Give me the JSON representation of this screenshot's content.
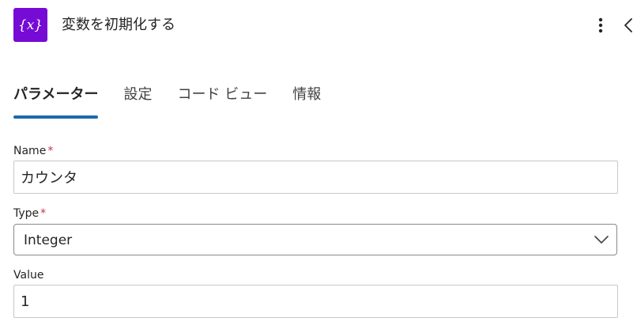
{
  "header": {
    "title": "変数を初期化する",
    "action_icon": "variable-icon",
    "action_icon_text": "{x}",
    "accent_color": "#770bd6",
    "more_icon": "more-vertical-icon",
    "collapse_icon": "chevron-left-icon"
  },
  "tabs": [
    {
      "label": "パラメーター",
      "active": true
    },
    {
      "label": "設定",
      "active": false
    },
    {
      "label": "コード ビュー",
      "active": false
    },
    {
      "label": "情報",
      "active": false
    }
  ],
  "tab_indicator_color": "#1a6aad",
  "fields": {
    "name": {
      "label": "Name",
      "required_mark": "*",
      "value": "カウンタ"
    },
    "type": {
      "label": "Type",
      "required_mark": "*",
      "value": "Integer",
      "dropdown_icon": "chevron-down-icon"
    },
    "value": {
      "label": "Value",
      "value": "1"
    }
  },
  "required_color": "#c4314b"
}
